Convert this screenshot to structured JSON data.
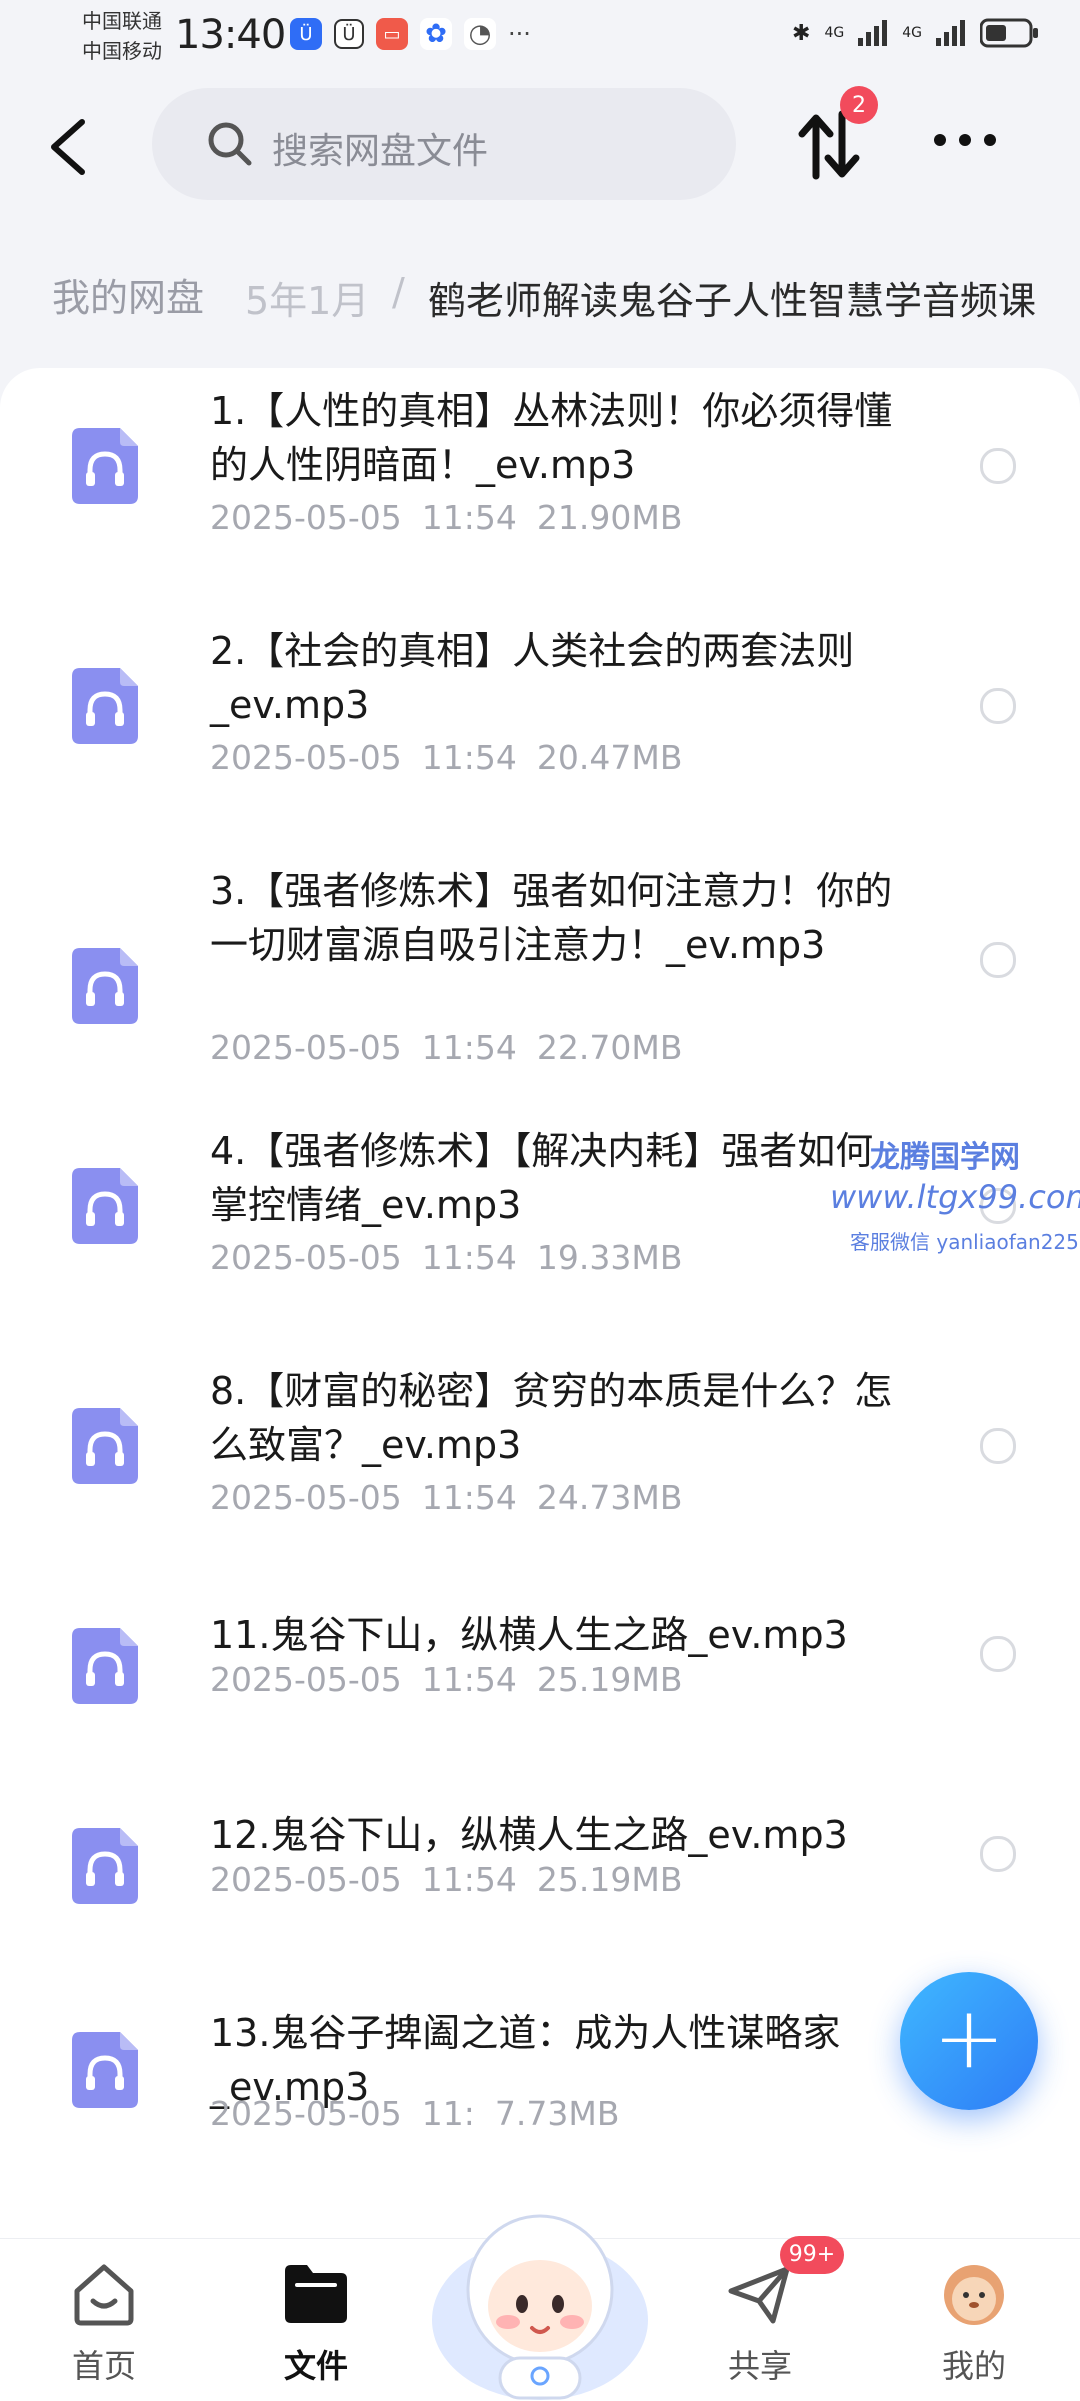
{
  "status_bar": {
    "carrier1": "中国联通",
    "carrier2": "中国移动",
    "time": "13:40",
    "net1": "4G",
    "net2": "4G"
  },
  "header": {
    "search_placeholder": "搜索网盘文件",
    "sort_badge": "2"
  },
  "breadcrumb": {
    "root": "我的网盘",
    "middle": "5年1月",
    "separator": "/",
    "current": "鹤老师解读鬼谷子人性智慧学音频课"
  },
  "files": [
    {
      "name": "1.【人性的真相】丛林法则！你必须得懂的人性阴暗面！_ev.mp3",
      "date": "2025-05-05",
      "time": "11:54",
      "size": "21.90MB"
    },
    {
      "name": "2.【社会的真相】人类社会的两套法则_ev.mp3",
      "date": "2025-05-05",
      "time": "11:54",
      "size": "20.47MB"
    },
    {
      "name": "3.【强者修炼术】强者如何注意力！你的一切财富源自吸引注意力！_ev.mp3",
      "date": "2025-05-05",
      "time": "11:54",
      "size": "22.70MB"
    },
    {
      "name": "4.【强者修炼术】【解决内耗】强者如何掌控情绪_ev.mp3",
      "date": "2025-05-05",
      "time": "11:54",
      "size": "19.33MB"
    },
    {
      "name": "8.【财富的秘密】贫穷的本质是什么？怎么致富？_ev.mp3",
      "date": "2025-05-05",
      "time": "11:54",
      "size": "24.73MB"
    },
    {
      "name": "11.鬼谷下山，纵横人生之路_ev.mp3",
      "date": "2025-05-05",
      "time": "11:54",
      "size": "25.19MB"
    },
    {
      "name": "12.鬼谷下山，纵横人生之路_ev.mp3",
      "date": "2025-05-05",
      "time": "11:54",
      "size": "25.19MB"
    },
    {
      "name": "13.鬼谷子捭阖之道：成为人性谋略家_ev.mp3",
      "date": "2025-05-05",
      "time": "11:",
      "size": "7.73MB"
    }
  ],
  "watermark": {
    "line1": "龙腾国学网",
    "line2": "www.ltgx99.com",
    "line3": "客服微信 yanliaofan225"
  },
  "fab": {
    "label": "+"
  },
  "nav": {
    "items": [
      {
        "label": "首页",
        "icon": "home-icon"
      },
      {
        "label": "文件",
        "icon": "folder-icon"
      },
      {
        "label": "共享",
        "icon": "share-icon"
      },
      {
        "label": "我的",
        "icon": "avatar-icon"
      }
    ],
    "share_badge": "99+"
  },
  "colors": {
    "accent": "#2e7cf6",
    "file_icon": "#8a8ff0",
    "badge": "#f24b5c",
    "muted": "#a6a8b0"
  }
}
